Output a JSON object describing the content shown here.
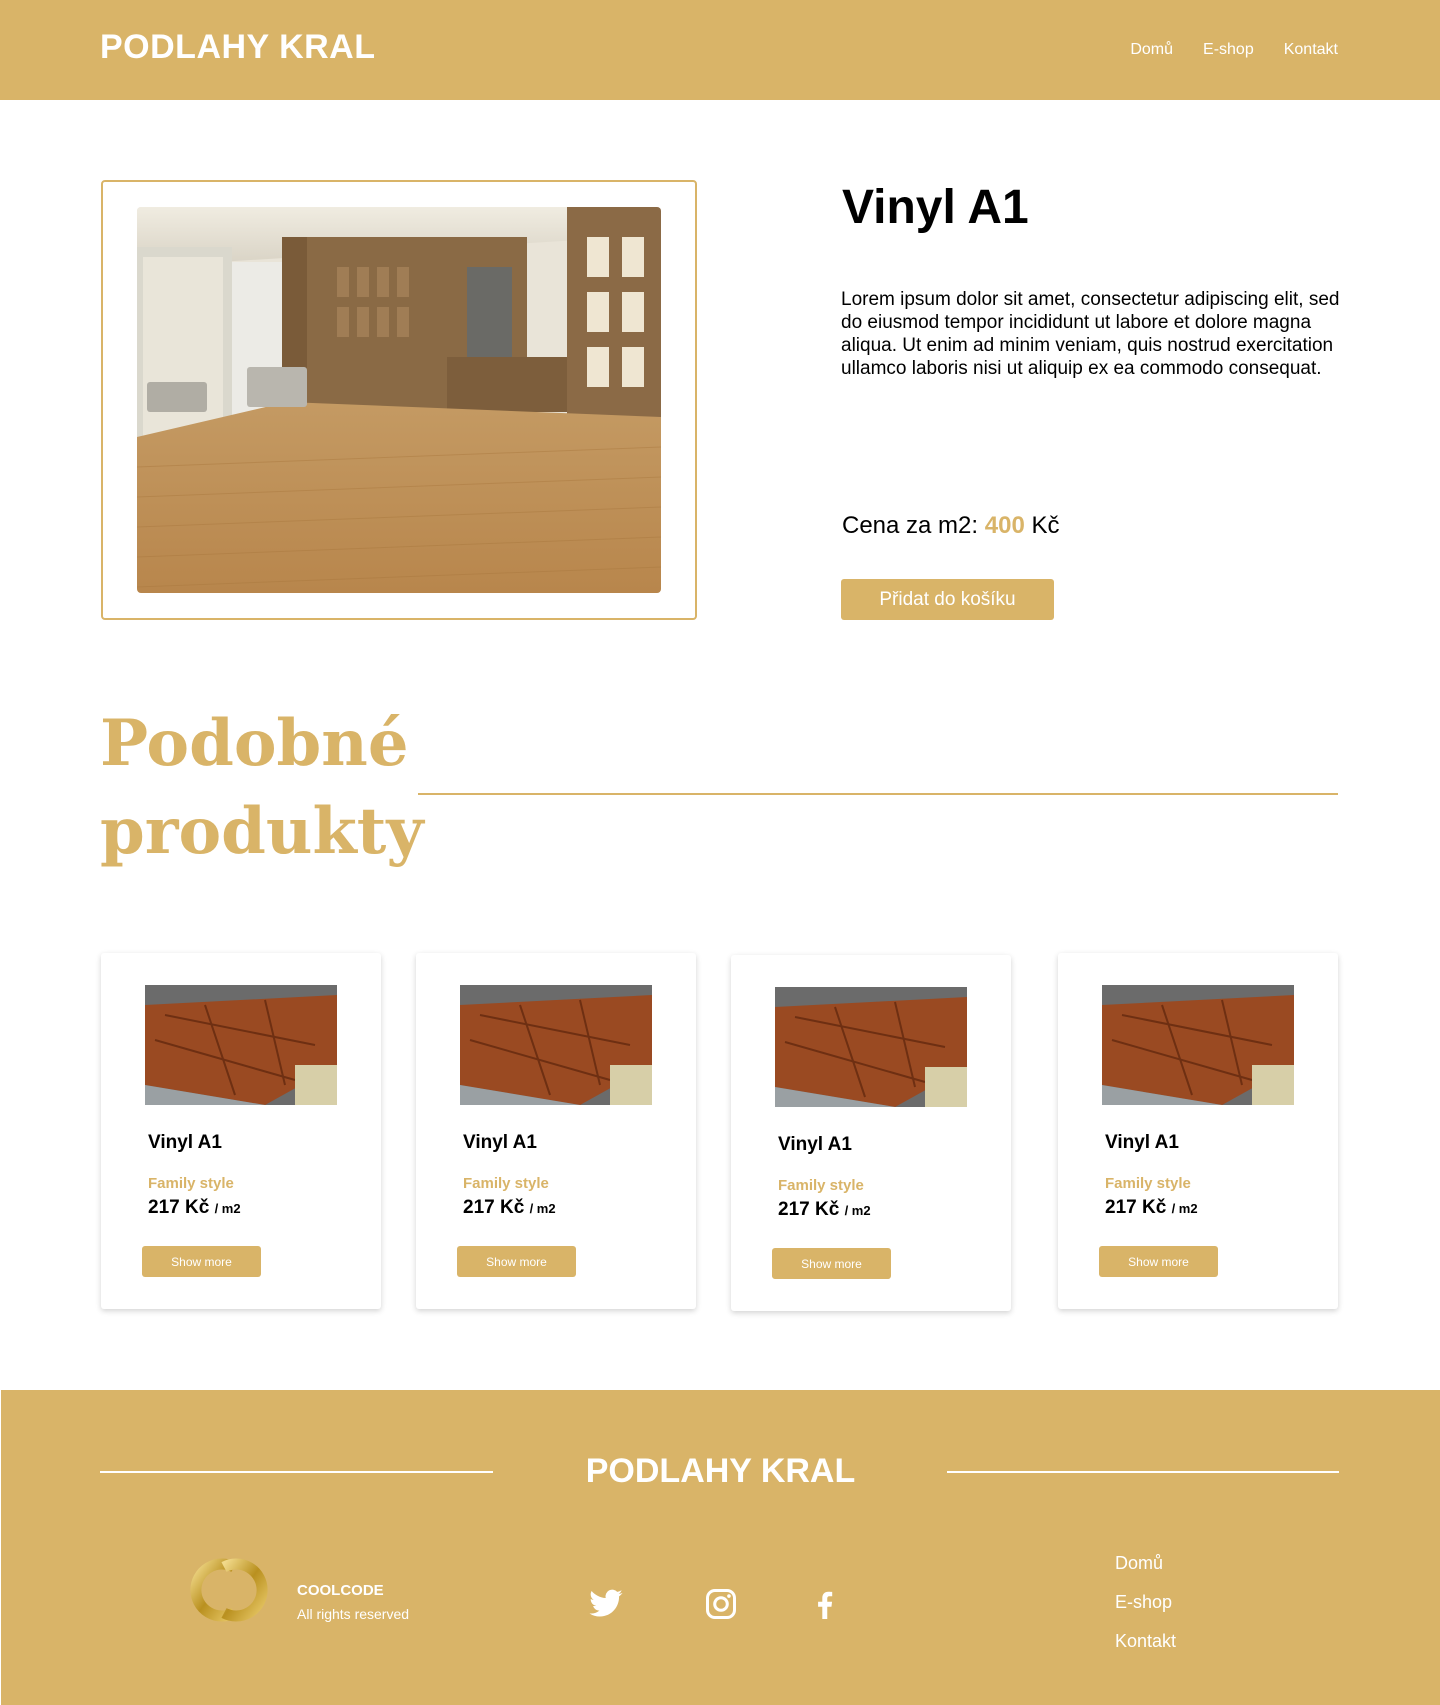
{
  "header": {
    "brand": "PODLAHY KRAL",
    "nav": [
      "Domů",
      "E-shop",
      "Kontakt"
    ]
  },
  "product": {
    "title": "Vinyl A1",
    "description": "Lorem ipsum dolor sit amet, consectetur adipiscing elit, sed do eiusmod tempor incididunt ut labore et dolore magna aliqua. Ut enim ad minim veniam, quis nostrud exercitation ullamco laboris nisi ut aliquip ex ea commodo consequat.",
    "price_label": "Cena za m2:",
    "price_value": "400",
    "price_currency": "Kč",
    "add_to_cart": "Přidat do košíku"
  },
  "similar": {
    "title": "Podobné produkty",
    "cards": [
      {
        "title": "Vinyl A1",
        "style": "Family style",
        "price": "217 Kč",
        "unit": "/ m2",
        "button": "Show more"
      },
      {
        "title": "Vinyl A1",
        "style": "Family style",
        "price": "217 Kč",
        "unit": "/ m2",
        "button": "Show more"
      },
      {
        "title": "Vinyl A1",
        "style": "Family style",
        "price": "217 Kč",
        "unit": "/ m2",
        "button": "Show more"
      },
      {
        "title": "Vinyl A1",
        "style": "Family style",
        "price": "217 Kč",
        "unit": "/ m2",
        "button": "Show more"
      }
    ]
  },
  "footer": {
    "brand": "PODLAHY KRAL",
    "company": "COOLCODE",
    "rights": "All rights reserved",
    "social_icons": [
      "twitter-icon",
      "instagram-icon",
      "facebook-icon"
    ],
    "nav": [
      "Domů",
      "E-shop",
      "Kontakt"
    ]
  },
  "colors": {
    "accent": "#D9B468",
    "text": "#000000",
    "background": "#ffffff"
  }
}
